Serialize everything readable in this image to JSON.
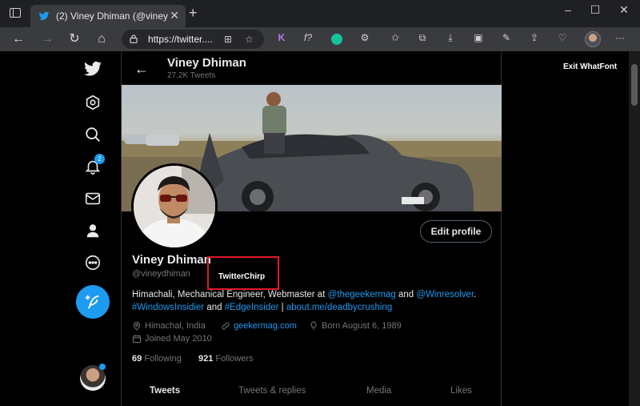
{
  "browser": {
    "tab_title": "(2) Viney Dhiman (@vineydhiman",
    "url": "https://twitter....",
    "new_tab_glyph": "+",
    "tab_close_glyph": "✕",
    "window_controls": [
      "–",
      "☐",
      "✕"
    ],
    "extension_labels": {
      "k": "K",
      "f": "f?"
    }
  },
  "sidebar": {
    "notification_count": "2"
  },
  "header": {
    "name": "Viney Dhiman",
    "tweet_count": "27.2K Tweets"
  },
  "profile": {
    "edit_button": "Edit profile",
    "name": "Viney Dhiman",
    "handle": "@vineydhiman",
    "bio": {
      "text1": "Himachali, Mechanical Engineer,  Webmaster at ",
      "link1": "@thegeekermag",
      "text2": " and ",
      "link2": "@Winresolver",
      "text3": ".",
      "link3": "#WindowsInsidier",
      "text4": " and ",
      "link4": "#EdgeInsider",
      "text5": " | ",
      "link5": "about.me/deadbycrushing"
    },
    "location": "Himachal, India",
    "website": "geekermag.com",
    "born": "Born August 6, 1989",
    "joined": "Joined May 2010",
    "following_count": "69",
    "following_label": "Following",
    "followers_count": "921",
    "followers_label": "Followers"
  },
  "profile_tabs": [
    "Tweets",
    "Tweets & replies",
    "Media",
    "Likes"
  ],
  "whatfont": {
    "tooltip_label": "TwitterChirp",
    "exit_label": "Exit WhatFont",
    "highlight_color": "#e0182a"
  },
  "colors": {
    "accent": "#1d9bf0",
    "background": "#000000",
    "muted": "#71767b"
  }
}
